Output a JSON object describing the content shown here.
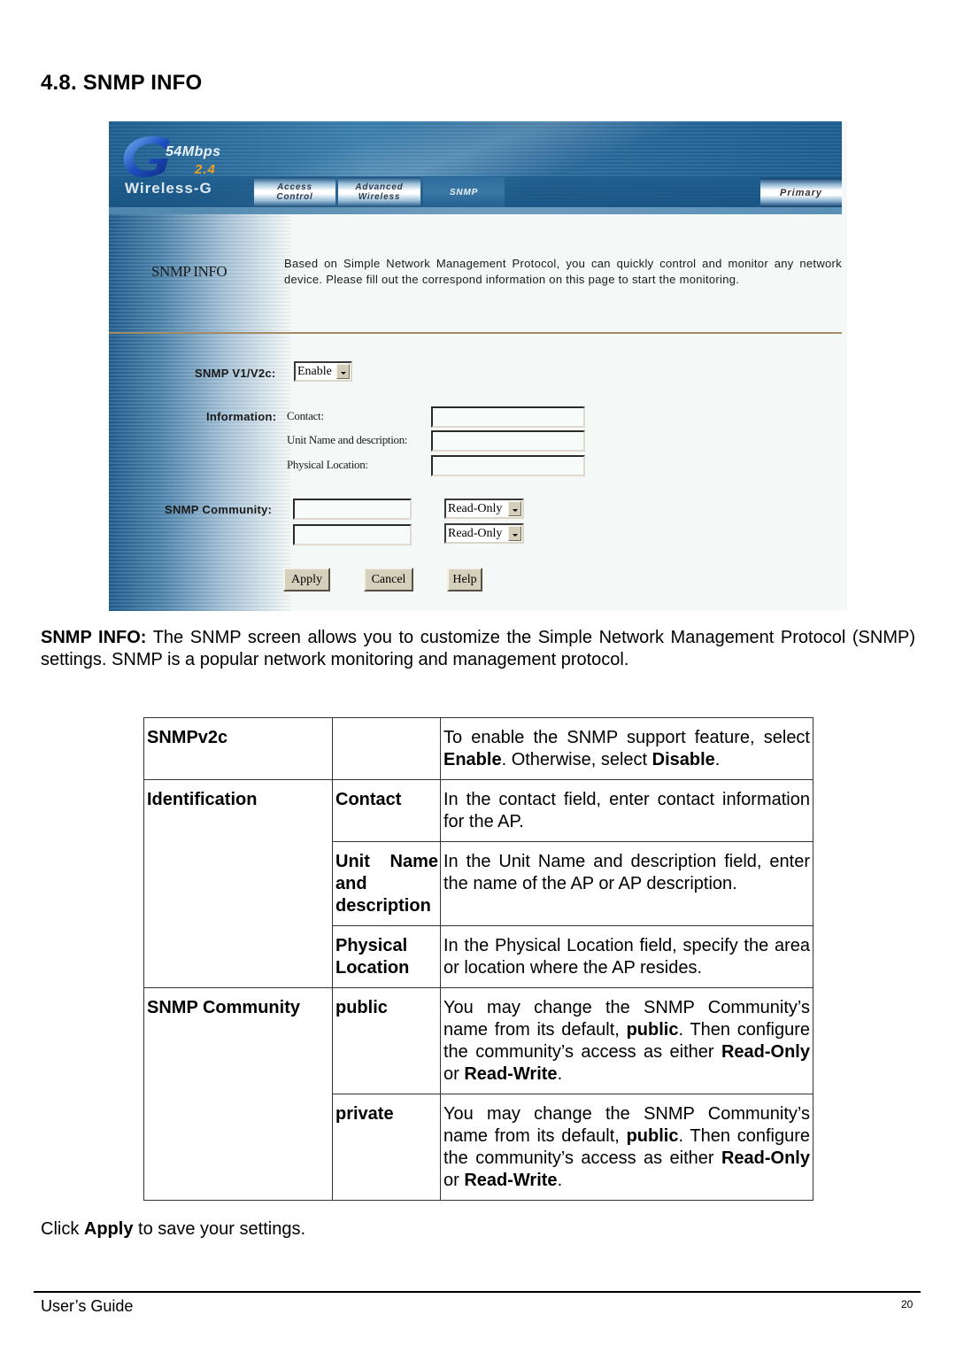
{
  "section": {
    "title": "4.8. SNMP INFO"
  },
  "router_ui": {
    "logo": {
      "speed": "54Mbps",
      "band": "2.4",
      "name": "Wireless-G"
    },
    "nav_tabs": [
      {
        "label_line1": "Access",
        "label_line2": "Control",
        "active": false
      },
      {
        "label_line1": "Advanced",
        "label_line2": "Wireless",
        "active": false
      },
      {
        "label_line1": "SNMP",
        "label_line2": "",
        "active": true
      }
    ],
    "primary_button": "Primary",
    "page_heading": "SNMP INFO",
    "page_description": "Based on Simple Network Management Protocol, you can quickly control and monitor any network device. Please fill out the correspond information on this page to start the monitoring.",
    "snmp_version": {
      "label": "SNMP V1/V2c:",
      "selected": "Enable"
    },
    "information": {
      "label": "Information:",
      "fields": [
        {
          "label": "Contact:",
          "value": ""
        },
        {
          "label": "Unit Name and description:",
          "value": ""
        },
        {
          "label": "Physical Location:",
          "value": ""
        }
      ]
    },
    "community": {
      "label": "SNMP Community:",
      "rows": [
        {
          "value": "",
          "access": "Read-Only"
        },
        {
          "value": "",
          "access": "Read-Only"
        }
      ]
    },
    "buttons": {
      "apply": "Apply",
      "cancel": "Cancel",
      "help": "Help"
    },
    "colors": {
      "banner_blue": "#1f5f91",
      "divider": "#a58a64",
      "button_face": "#d5d0bc",
      "content_bg": "#f4f9f7"
    }
  },
  "intro": {
    "bold": "SNMP INFO:",
    "text": " The SNMP screen allows you to customize the Simple Network Management Protocol (SNMP) settings. SNMP is a popular network monitoring and management protocol."
  },
  "reference_table": {
    "rows": [
      {
        "group": "SNMPv2c",
        "field": "",
        "description": [
          {
            "t": "To enable the SNMP support feature, select "
          },
          {
            "b": "Enable"
          },
          {
            "t": ". Otherwise, select "
          },
          {
            "b": "Disable"
          },
          {
            "t": "."
          }
        ]
      },
      {
        "group": "Identification",
        "field": "Contact",
        "description": [
          {
            "t": "In the contact field, enter contact information for the AP."
          }
        ]
      },
      {
        "group": "",
        "field": "Unit Name and description",
        "description": [
          {
            "t": "In the Unit Name and description field, enter the name of the AP or AP description."
          }
        ]
      },
      {
        "group": "",
        "field": "Physical Location",
        "description": [
          {
            "t": "In the Physical Location field, specify the area or location where the AP resides."
          }
        ]
      },
      {
        "group": "SNMP Community",
        "field": "public",
        "description": [
          {
            "t": "You may change the SNMP Community’s name from its default, "
          },
          {
            "b": "public"
          },
          {
            "t": ". Then configure the community’s access as either "
          },
          {
            "b": "Read-Only"
          },
          {
            "t": " or "
          },
          {
            "b": "Read-Write"
          },
          {
            "t": "."
          }
        ]
      },
      {
        "group": "",
        "field": "private",
        "description": [
          {
            "t": "You may change the SNMP Community’s name from its default, "
          },
          {
            "b": "public"
          },
          {
            "t": ". Then configure the community’s access as either "
          },
          {
            "b": "Read-Only"
          },
          {
            "t": " or "
          },
          {
            "b": "Read-Write"
          },
          {
            "t": "."
          }
        ]
      }
    ]
  },
  "outro": {
    "prefix": "Click ",
    "bold": "Apply",
    "suffix": " to save your settings."
  },
  "footer": {
    "left": "User’s Guide",
    "page_number": "20"
  }
}
